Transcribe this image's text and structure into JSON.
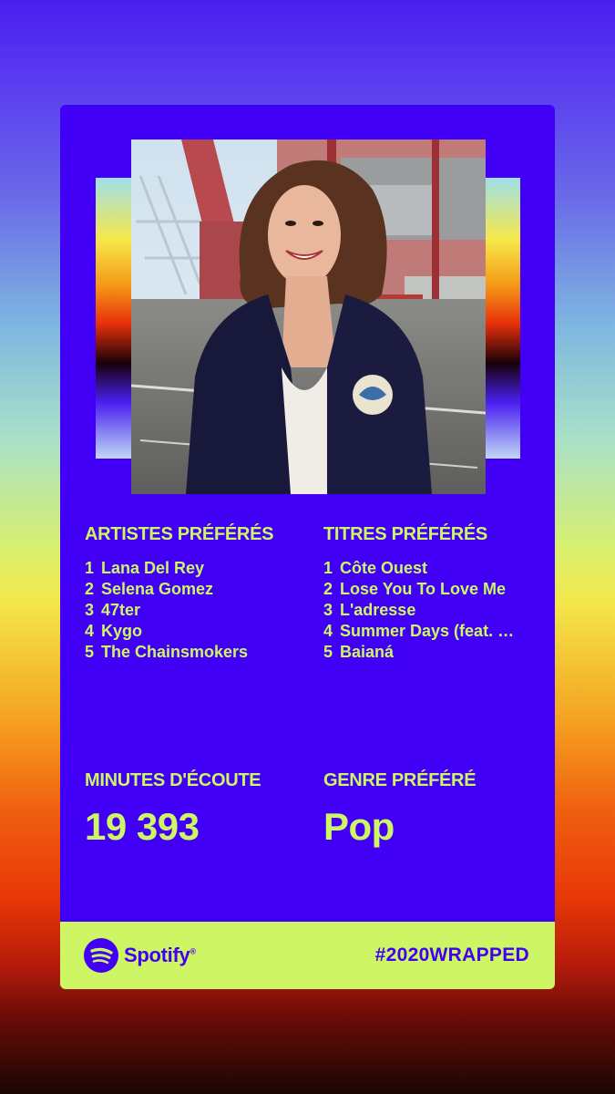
{
  "artists": {
    "title": "ARTISTES PRÉFÉRÉS",
    "items": [
      {
        "num": "1",
        "name": "Lana Del Rey"
      },
      {
        "num": "2",
        "name": "Selena Gomez"
      },
      {
        "num": "3",
        "name": "47ter"
      },
      {
        "num": "4",
        "name": "Kygo"
      },
      {
        "num": "5",
        "name": "The Chainsmokers"
      }
    ]
  },
  "tracks": {
    "title": "TITRES PRÉFÉRÉS",
    "items": [
      {
        "num": "1",
        "name": "Côte Ouest"
      },
      {
        "num": "2",
        "name": "Lose You To Love Me"
      },
      {
        "num": "3",
        "name": "L'adresse"
      },
      {
        "num": "4",
        "name": "Summer Days (feat. …"
      },
      {
        "num": "5",
        "name": "Baianá"
      }
    ]
  },
  "minutes": {
    "title": "MINUTES D'ÉCOUTE",
    "value": "19 393"
  },
  "genre": {
    "title": "GENRE PRÉFÉRÉ",
    "value": "Pop"
  },
  "footer": {
    "brand": "Spotify",
    "registered": "®",
    "hashtag": "#2020WRAPPED",
    "logo_icon": "spotify-logo-icon"
  },
  "colors": {
    "card": "#4100f5",
    "accent": "#cdf564"
  }
}
